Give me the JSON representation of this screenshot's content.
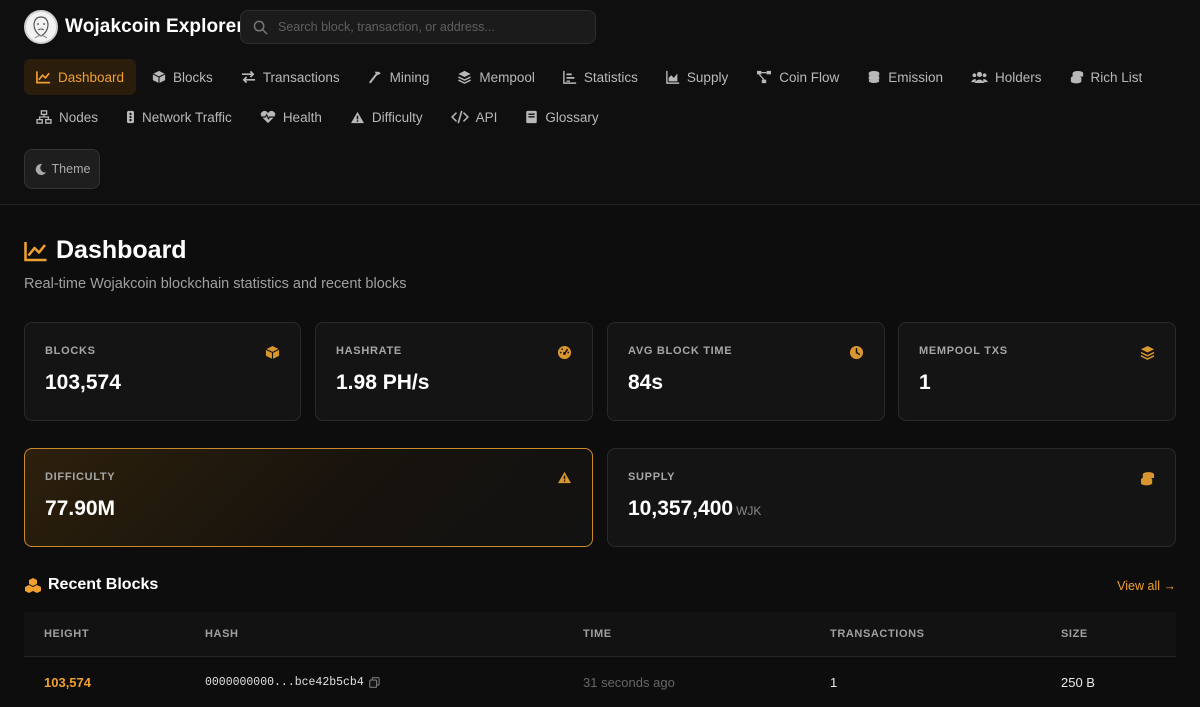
{
  "brand": {
    "title": "Wojakcoin Explorer"
  },
  "search": {
    "placeholder": "Search block, transaction, or address..."
  },
  "nav": {
    "items": [
      {
        "label": "Dashboard",
        "icon": "chart-line-icon"
      },
      {
        "label": "Blocks",
        "icon": "cube-icon"
      },
      {
        "label": "Transactions",
        "icon": "arrows-exchange-icon"
      },
      {
        "label": "Mining",
        "icon": "hammer-icon"
      },
      {
        "label": "Mempool",
        "icon": "layers-icon"
      },
      {
        "label": "Statistics",
        "icon": "bar-chart-icon"
      },
      {
        "label": "Supply",
        "icon": "area-chart-icon"
      },
      {
        "label": "Coin Flow",
        "icon": "flow-icon"
      },
      {
        "label": "Emission",
        "icon": "coins-icon"
      },
      {
        "label": "Holders",
        "icon": "users-icon"
      },
      {
        "label": "Rich List",
        "icon": "coins-stack-icon"
      },
      {
        "label": "Nodes",
        "icon": "network-icon"
      },
      {
        "label": "Network Traffic",
        "icon": "traffic-icon"
      },
      {
        "label": "Health",
        "icon": "heart-pulse-icon"
      },
      {
        "label": "Difficulty",
        "icon": "triangle-icon"
      },
      {
        "label": "API",
        "icon": "code-icon"
      },
      {
        "label": "Glossary",
        "icon": "book-icon"
      }
    ],
    "active": "Dashboard"
  },
  "theme": {
    "label": "Theme"
  },
  "page": {
    "title": "Dashboard",
    "subtitle": "Real-time Wojakcoin blockchain statistics and recent blocks"
  },
  "stats": {
    "blocks": {
      "label": "BLOCKS",
      "value": "103,574"
    },
    "hashrate": {
      "label": "HASHRATE",
      "value": "1.98 PH/s"
    },
    "avg_block_time": {
      "label": "AVG BLOCK TIME",
      "value": "84s"
    },
    "mempool_txs": {
      "label": "MEMPOOL TXS",
      "value": "1"
    },
    "difficulty": {
      "label": "DIFFICULTY",
      "value": "77.90M"
    },
    "supply": {
      "label": "SUPPLY",
      "value": "10,357,400",
      "unit": "WJK"
    }
  },
  "recent_blocks": {
    "title": "Recent Blocks",
    "view_all": "View all →",
    "columns": [
      "HEIGHT",
      "HASH",
      "TIME",
      "TRANSACTIONS",
      "SIZE"
    ],
    "rows": [
      {
        "height": "103,574",
        "hash": "0000000000...bce42b5cb4",
        "time": "31 seconds ago",
        "transactions": "1",
        "size": "250 B"
      }
    ]
  },
  "colors": {
    "accent": "#f0a030",
    "background": "#0d0d0d",
    "card": "#141414"
  }
}
